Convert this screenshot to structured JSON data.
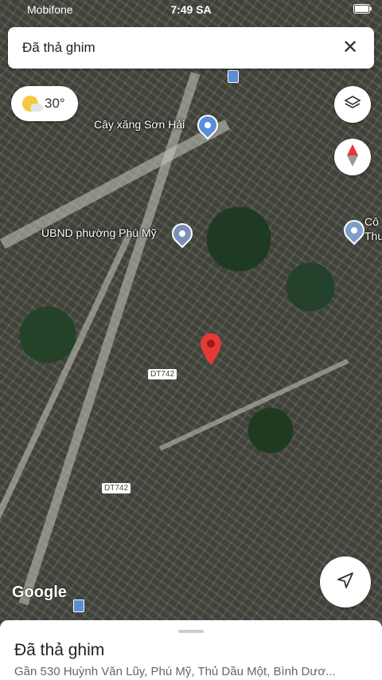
{
  "status": {
    "carrier": "Mobifone",
    "time": "7:49 SA",
    "battery_icon": "battery-icon"
  },
  "search": {
    "title": "Đã thả ghim",
    "close_icon": "close-icon"
  },
  "weather": {
    "temp": "30°"
  },
  "map": {
    "labels": {
      "gas": "Cây xăng Sơn Hải",
      "ubnd": "UBND phường Phú Mỹ",
      "cong": "Cô",
      "thu": "Thu"
    },
    "roads": {
      "r1": "DT742",
      "r2": "DT742"
    },
    "logo": "Google"
  },
  "sheet": {
    "title": "Đã thả ghim",
    "address": "Gần 530 Huỳnh Văn Lũy, Phú Mỹ, Thủ Dầu Một, Bình Dươ..."
  }
}
